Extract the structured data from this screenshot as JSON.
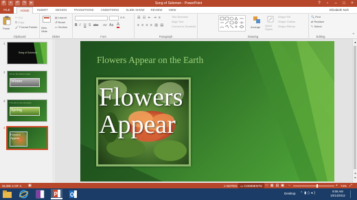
{
  "window": {
    "title": "Song of Solomon - PowerPoint",
    "help": "?"
  },
  "quick_access": [
    "save-icon",
    "undo-icon",
    "redo-icon",
    "start-icon"
  ],
  "tabs": {
    "file": "FILE",
    "items": [
      {
        "label": "HOME",
        "active": true
      },
      {
        "label": "INSERT"
      },
      {
        "label": "DESIGN"
      },
      {
        "label": "TRANSITIONS"
      },
      {
        "label": "ANIMATIONS"
      },
      {
        "label": "SLIDE SHOW"
      },
      {
        "label": "REVIEW"
      },
      {
        "label": "VIEW"
      }
    ]
  },
  "user": "Elizabeth Noh",
  "ribbon": {
    "clipboard": {
      "paste": "Paste",
      "cut": "Cut",
      "copy": "Copy",
      "format_painter": "Format Painter",
      "label": "Clipboard"
    },
    "slides": {
      "new_slide": "New Slide",
      "layout": "Layout",
      "reset": "Reset",
      "section": "Section",
      "label": "Slides"
    },
    "font": {
      "bold": "B",
      "italic": "I",
      "underline": "U",
      "strike": "S",
      "shadow": "abc",
      "font_color": "A",
      "aa": "Aa",
      "label": "Font"
    },
    "paragraph": {
      "text_direction": "Text Direction",
      "align_text": "Align Text",
      "smartart": "Convert to SmartArt",
      "label": "Paragraph"
    },
    "drawing": {
      "arrange": "Arrange",
      "quick_styles": "Quick Styles",
      "shape_fill": "Shape Fill",
      "shape_outline": "Shape Outline",
      "shape_effects": "Shape Effects",
      "label": "Drawing"
    },
    "editing": {
      "find": "Find",
      "replace": "Replace",
      "select": "Select",
      "label": "Editing"
    }
  },
  "slides": [
    {
      "number": "1",
      "title": "Song of Solomon"
    },
    {
      "number": "2",
      "title": "Winter",
      "caption": "For lo, the winter is past"
    },
    {
      "number": "3",
      "title": "Spring",
      "caption": "The rain is over and gone"
    },
    {
      "number": "4",
      "title": "Flowers Appear",
      "selected": true
    }
  ],
  "current_slide": {
    "title": "Flowers Appear on the Earth",
    "picture_text_line1": "Flowers",
    "picture_text_line2": "Appear"
  },
  "statusbar": {
    "slide_info": "SLIDE 4 OF 4",
    "notes": "NOTES",
    "comments": "COMMENTS",
    "zoom": "74%"
  },
  "taskbar": {
    "desktop": "Desktop",
    "time": "9:06 AM",
    "date": "10/14/2012"
  },
  "colors": {
    "accent": "#b7472a",
    "slide_title": "#9fd07a",
    "taskbar": "#1b3c66"
  }
}
